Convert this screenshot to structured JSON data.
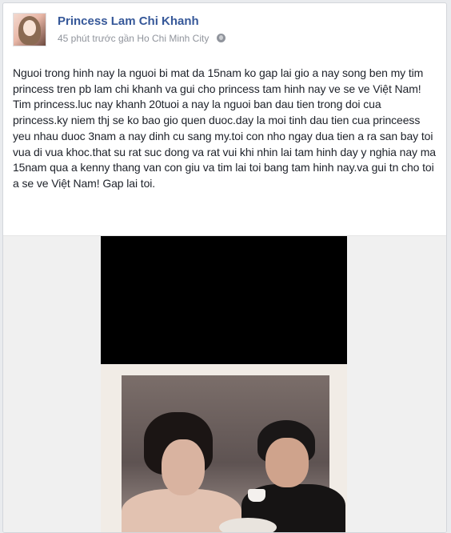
{
  "post": {
    "author_name": "Princess Lam Chi Khanh",
    "time_ago": "45 phút trước",
    "location_prefix": "gần",
    "location": "Ho Chi Minh City",
    "privacy_icon": "globe-icon",
    "text": "Nguoi trong hinh nay la nguoi bi mat da 15nam ko gap lai gio a nay song ben my tim princess tren pb lam chi khanh va gui cho princess tam hinh nay ve se ve Việt Nam! Tim princess.luc nay khanh 20tuoi a nay la nguoi ban dau tien trong doi cua princess.ky niem thj se ko bao gio quen duoc.day la moi tinh dau tien cua princeess yeu nhau duoc 3nam a nay dinh cu sang my.toi con nho ngay dua tien a ra san bay toi vua di vua khoc.that su rat suc dong va rat vui khi nhin lai tam hinh day y nghia nay ma 15nam qua a kenny thang van con giu va tim lai toi bang tam hinh nay.va gui tn cho toi a se ve Việt Nam! Gap lai toi."
  },
  "colors": {
    "author_link": "#365899",
    "meta_text": "#90949c",
    "body_text": "#1d2129",
    "card_bg": "#ffffff",
    "page_bg": "#e9ebee"
  }
}
